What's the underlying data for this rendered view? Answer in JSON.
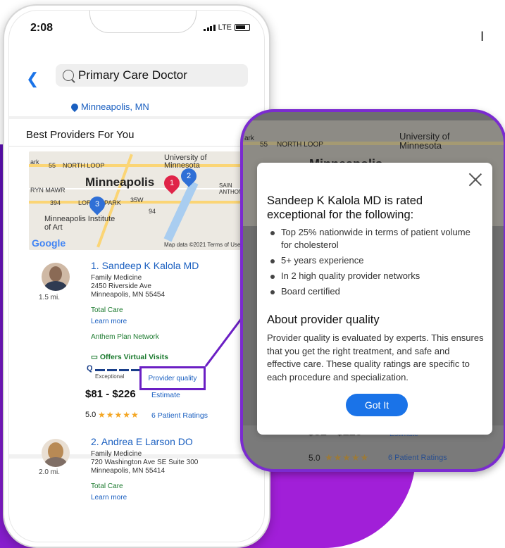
{
  "status": {
    "time": "2:08",
    "network": "LTE"
  },
  "search": {
    "query": "Primary Care Doctor"
  },
  "location": {
    "label": "Minneapolis, MN"
  },
  "section": {
    "title": "Best Providers For You"
  },
  "map": {
    "city": "Minneapolis",
    "labels": [
      "ark",
      "55",
      "NORTH LOOP",
      "University of Minnesota",
      "RYN MAWR",
      "394",
      "LORING PARK",
      "35W",
      "94",
      "SAIN ANTHON",
      "Minneapolis Institute of Art"
    ],
    "google": "Google",
    "credit": "Map data ©2021   Terms of Use",
    "markers": [
      "1",
      "2",
      "3"
    ]
  },
  "providers": [
    {
      "name": "1. Sandeep K Kalola MD",
      "specialty": "Family Medicine",
      "address1": "2450 Riverside Ave",
      "address2": "Minneapolis, MN 55454",
      "distance": "1.5 mi.",
      "plan": "Total Care",
      "learn_more": "Learn more",
      "network": "Anthem Plan Network",
      "virtual": "Offers Virtual Visits",
      "quality_letter": "Q",
      "quality_caption": "Exceptional",
      "quality_link": "Provider quality",
      "price": "$81 - $226",
      "estimate": "Estimate",
      "rating": "5.0",
      "ratings_link": "6 Patient Ratings"
    },
    {
      "name": "2. Andrea E Larson DO",
      "specialty": "Family Medicine",
      "address1": "720 Washington Ave SE Suite 300",
      "address2": "Minneapolis, MN 55414",
      "distance": "2.0 mi.",
      "plan": "Total Care",
      "learn_more": "Learn more"
    }
  ],
  "zoom": {
    "map_labels": [
      "ark",
      "55",
      "NORTH LOOP",
      "University of Minnesota",
      "Minneapolis"
    ],
    "price": "$81 - $226",
    "estimate": "Estimate",
    "rating": "5.0",
    "ratings_link": "6 Patient Ratings"
  },
  "modal": {
    "title": "Sandeep K Kalola MD is rated exceptional for the following:",
    "reasons": [
      "Top 25% nationwide in terms of patient volume for cholesterol",
      "5+ years experience",
      "In 2 high quality provider networks",
      "Board certified"
    ],
    "about_title": "About provider quality",
    "about_text": "Provider quality is evaluated by experts. This ensures that you get the right treatment, and safe and effective care. These quality ratings are specific to each procedure and specialization.",
    "button": "Got It"
  },
  "side_letter": "I",
  "colors": {
    "accent": "#1a73e8",
    "purple": "#7b2bd0",
    "green": "#1b7a2e",
    "star": "#f4a623"
  }
}
